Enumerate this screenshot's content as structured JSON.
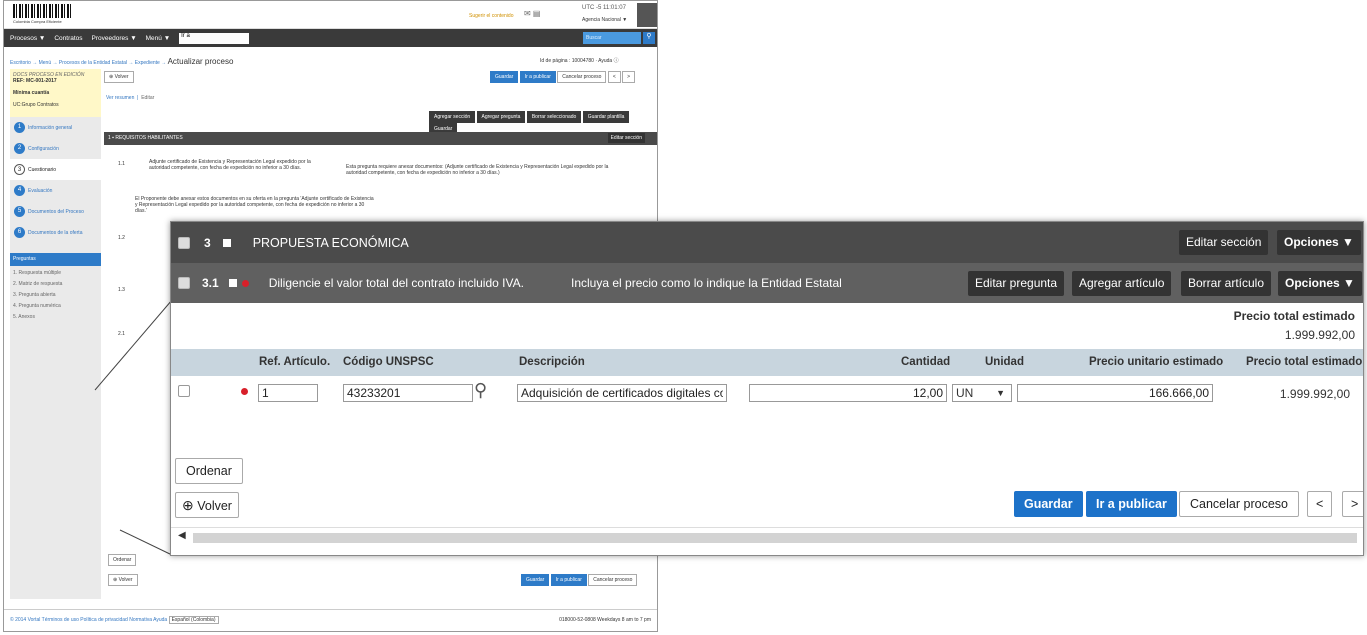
{
  "bg": {
    "logo": "Colombia Compra Eficiente",
    "suggest": "Sugerir el contenido",
    "utc": "UTC -5 11:01:07",
    "agency": "Agencia Nacional",
    "nav": [
      "Procesos ▼",
      "Contratos",
      "Proveedores ▼",
      "Menú ▼"
    ],
    "ir_a": "Ir a",
    "buscar": "Buscar",
    "breadcrumb": "Escritorio → Menú → Procesos de la Entidad Estatal → Expediente →",
    "title": "Actualizar proceso",
    "page_id": "Id de página : 10004780",
    "ayuda": "Ayuda",
    "draft": "DOCS PROCESO EN EDICIÓN",
    "ref": "REF: MC-001-2017",
    "editar": "Editar",
    "minima": "Mínima cuantía",
    "grupo": "UC:Grupo Contratos",
    "steps": [
      {
        "n": "1",
        "label": "Información general"
      },
      {
        "n": "2",
        "label": "Configuración"
      },
      {
        "n": "3",
        "label": "Cuestionario"
      },
      {
        "n": "4",
        "label": "Evaluación"
      },
      {
        "n": "5",
        "label": "Documentos del Proceso"
      },
      {
        "n": "6",
        "label": "Documentos de la oferta"
      }
    ],
    "preguntas": "Preguntas",
    "preg_list": [
      "1. Respuesta múltiple",
      "2. Matriz de respuesta",
      "3. Pregunta abierta",
      "4. Pregunta numérica",
      "5. Anexos"
    ],
    "volver": "Volver",
    "guardar": "Guardar",
    "ir_publicar": "Ir a publicar",
    "cancelar": "Cancelar proceso",
    "ver_resumen": "Ver resumen",
    "editar2": "Editar",
    "toolbar": [
      "Agregar sección",
      "Agregar pregunta",
      "Borrar seleccionado",
      "Guardar plantilla",
      "Guardar"
    ],
    "sec1": "1  ▪  REQUISITOS HABILITANTES",
    "editar_seccion": "Editar sección",
    "q11": "Adjunte certificado de Existencia y Representación Legal expedido por la autoridad competente, con fecha de expedición no inferior a 30 días.",
    "q11_note": "Esta pregunta requiere anexar documentos: (Adjunte certificado de Existencia y Representación Legal expedido por la autoridad competente, con fecha de expedición no inferior a 30 días.)",
    "q11_text": "El Proponente debe anexar estos documentos en su oferta en la pregunta 'Adjunte certificado de Existencia y Representación Legal expedido por la autoridad competente, con fecha de expedición no inferior a 30 días.'",
    "ordenar": "Ordenar",
    "footer": "© 2014 Vortal   Términos de uso   Política de privacidad   Normativa   Ayuda",
    "lang": "Español (Colombia)",
    "phone": "018000-52-0808   Weekdays 8 am to 7 pm"
  },
  "zoom": {
    "section_num": "3",
    "section_title": "PROPUESTA ECONÓMICA",
    "editar_seccion": "Editar sección",
    "opciones": "Opciones ▼",
    "q_num": "3.1",
    "q_title": "Diligencie el valor total del contrato incluido IVA.",
    "q_hint": "Incluya el precio como lo indique la Entidad Estatal",
    "editar_pregunta": "Editar pregunta",
    "agregar_articulo": "Agregar artículo",
    "borrar_articulo": "Borrar artículo",
    "total_label": "Precio total estimado",
    "total_value": "1.999.992,00",
    "columns": {
      "ref": "Ref. Artículo.",
      "unspsc": "Código UNSPSC",
      "desc": "Descripción",
      "cant": "Cantidad",
      "unidad": "Unidad",
      "punit": "Precio unitario estimado",
      "ptotal": "Precio total estimado"
    },
    "row": {
      "ref": "1",
      "unspsc": "43233201",
      "desc": "Adquisición de certificados digitales co",
      "cant": "12,00",
      "unidad": "UN",
      "punit": "166.666,00",
      "ptotal": "1.999.992,00"
    },
    "ordenar": "Ordenar",
    "volver": "Volver",
    "guardar": "Guardar",
    "ir_publicar": "Ir a publicar",
    "cancelar": "Cancelar proceso",
    "prev": "<",
    "next": ">"
  }
}
